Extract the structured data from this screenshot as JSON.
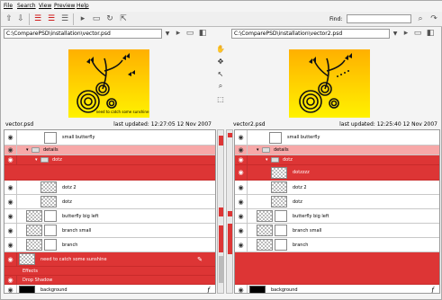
{
  "menu": [
    "File",
    "Search",
    "View",
    "Preview",
    "Help"
  ],
  "find_label": "Find:",
  "find_value": "",
  "left": {
    "path": "C:\\ComparePSD\\installation\\vector.psd",
    "thumb_text": "need to catch some sunshine",
    "filename": "vector.psd",
    "updated": "last updated: 12:27:05 12 Nov 2007"
  },
  "right": {
    "path": "C:\\ComparePSD\\installation\\vector2.psd",
    "filename": "vector2.psd",
    "updated": "last updated: 12:25:40 12 Nov 2007"
  },
  "left_layers": {
    "r1": "small butterfly",
    "r2": "details",
    "r3": "dotz",
    "r5": "dotz 2",
    "r6": "dotz",
    "r7": "butterfly big left",
    "r8": "branch small",
    "r9": "branch",
    "r10": "need to catch some sunshine",
    "r11": "Effects",
    "r12": "Drop Shadow",
    "r13": "background"
  },
  "right_layers": {
    "r1": "small butterfly",
    "r2": "details",
    "r3": "dotz",
    "r4": "dotzzzz",
    "r5": "dotz 2",
    "r6": "dotz",
    "r7": "butterfly big left",
    "r8": "branch small",
    "r9": "branch",
    "r13": "background"
  },
  "colors": {
    "changed": "#dd3535",
    "changed_light": "#f7a8a8",
    "thumb_top": "#ffb300",
    "thumb_bottom": "#fff200"
  }
}
